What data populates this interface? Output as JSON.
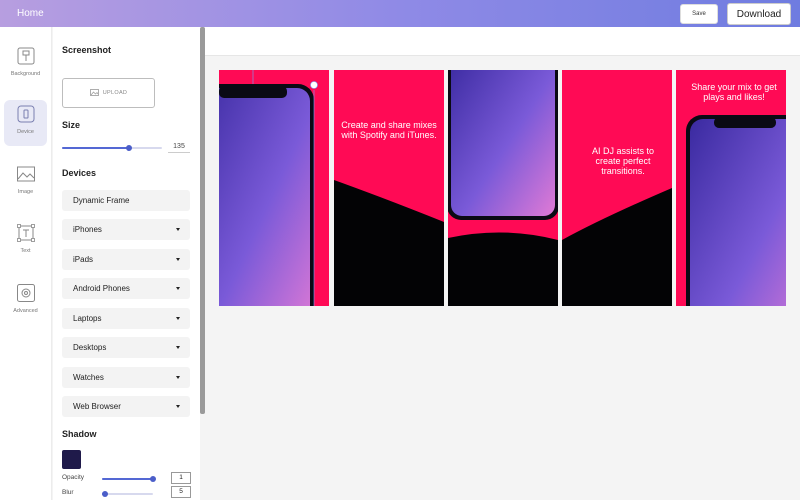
{
  "header": {
    "home_label": "Home",
    "save_label": "Save",
    "download_label": "Download"
  },
  "rail": [
    {
      "label": "Background",
      "icon": "paint-bucket-icon"
    },
    {
      "label": "Device",
      "icon": "phone-icon"
    },
    {
      "label": "Image",
      "icon": "image-icon"
    },
    {
      "label": "Text",
      "icon": "text-icon"
    },
    {
      "label": "Advanced",
      "icon": "gear-icon"
    }
  ],
  "panel": {
    "screenshot_title": "Screenshot",
    "upload_label": "UPLOAD",
    "size_title": "Size",
    "size_value": "135",
    "size_level": 0.67,
    "devices_title": "Devices",
    "devices": [
      "Dynamic Frame",
      "iPhones",
      "iPads",
      "Android Phones",
      "Laptops",
      "Desktops",
      "Watches",
      "Web Browser"
    ],
    "shadow_title": "Shadow",
    "shadow_color": "#1f1a4a",
    "opacity_label": "Opacity",
    "opacity_value": "1",
    "opacity_level": 1.0,
    "blur_label": "Blur",
    "blur_value": "5",
    "blur_level": 0.05
  },
  "canvas": {
    "captions": [
      "",
      "Create and share mixes with Spotify and iTunes.",
      "",
      "AI DJ assists to create perfect transitions.",
      "Share your mix to get plays and likes!"
    ]
  },
  "colors": {
    "accent": "#5468d4",
    "slide_pink": "#ff0a55",
    "slide_dark": "#030305"
  }
}
